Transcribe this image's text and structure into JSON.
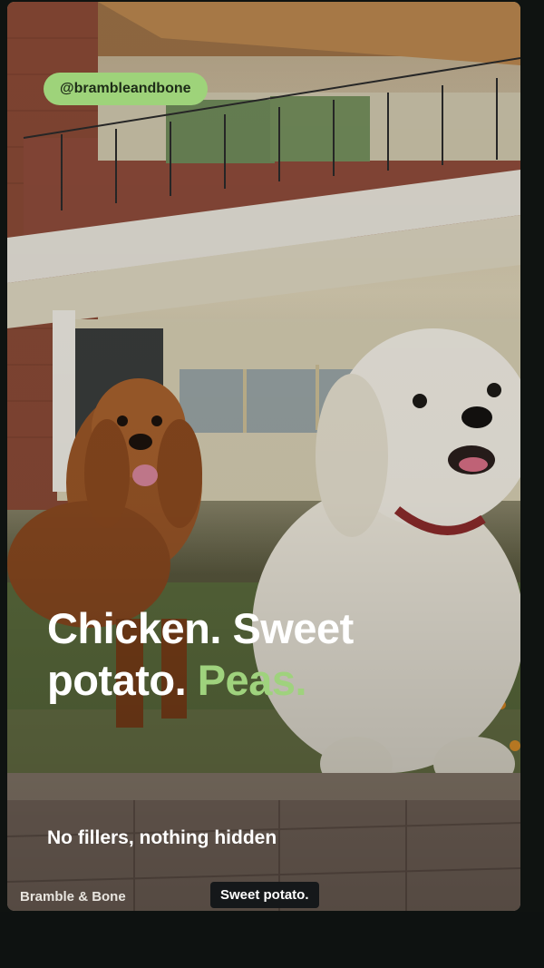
{
  "social": {
    "handle": "@brambleandbone"
  },
  "headline": {
    "line1": "Chicken. Sweet",
    "line2_white": "potato.",
    "line2_accent": "Peas."
  },
  "subline": "No fillers, nothing hidden",
  "footer": {
    "brand": "Bramble & Bone",
    "caption": "Sweet potato."
  },
  "colors": {
    "accent": "#9fd27d",
    "handle_bg": "#9ed37a",
    "caption_bg": "#15181a"
  }
}
